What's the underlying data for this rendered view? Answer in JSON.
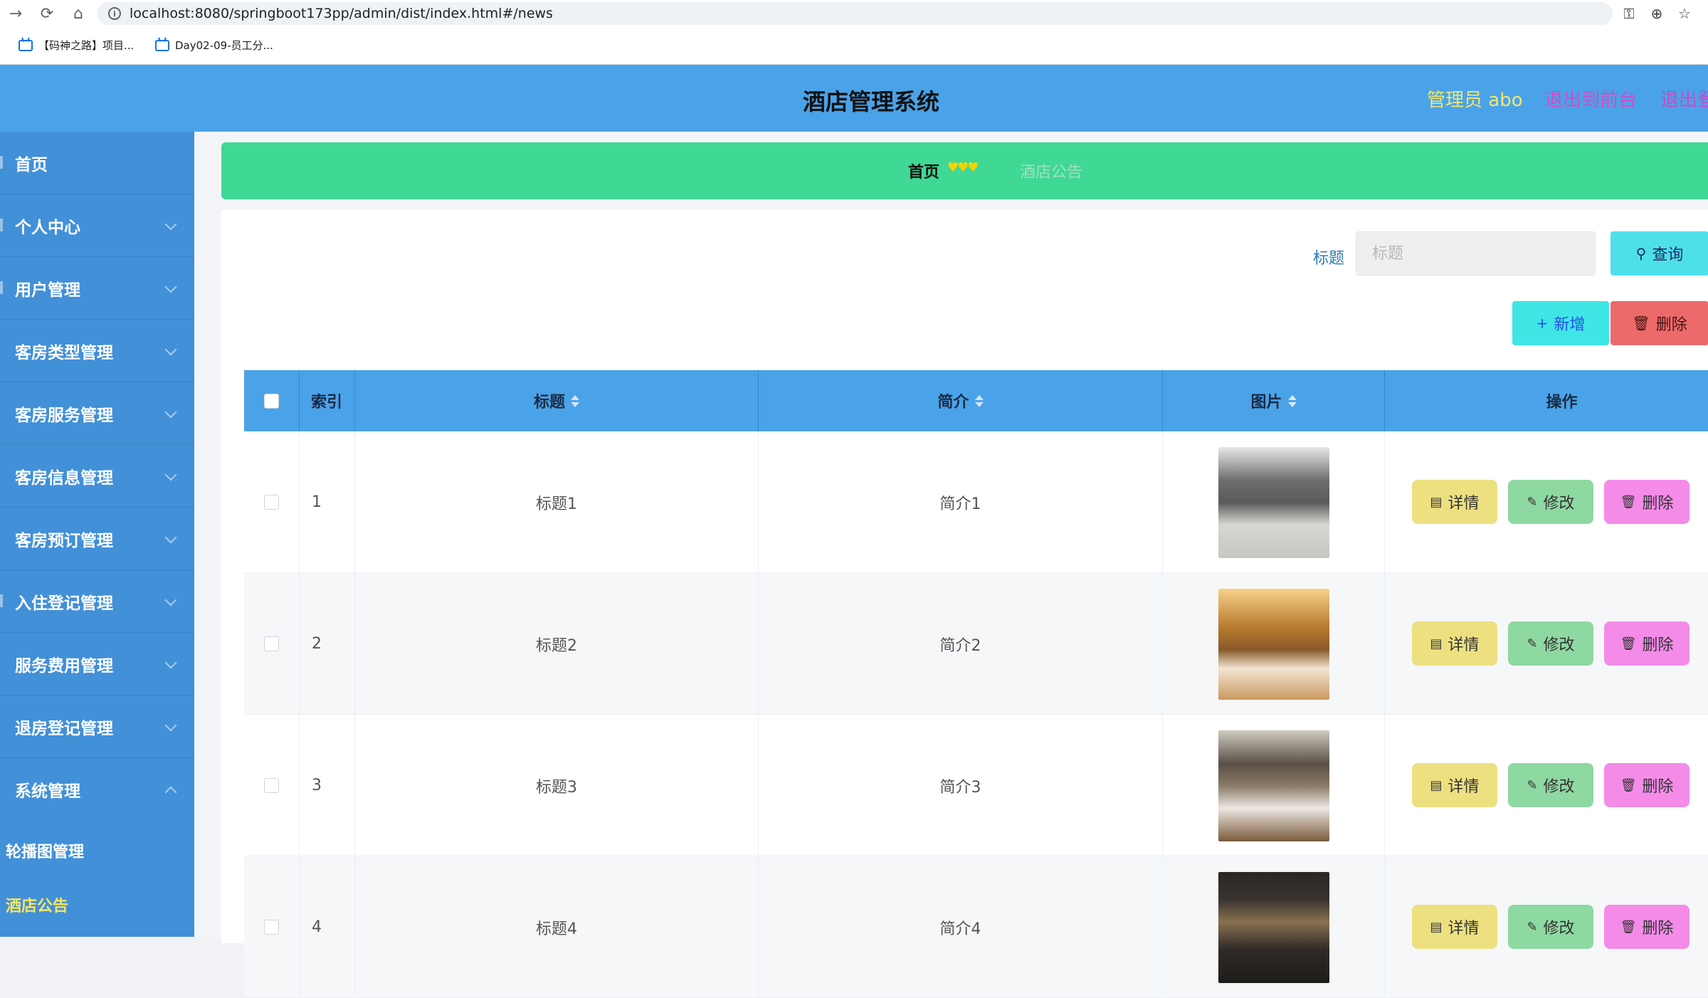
{
  "browser": {
    "url": "localhost:8080/springboot173pp/admin/dist/index.html#/news",
    "bookmarks": [
      "【码神之路】项目...",
      "Day02-09-员工分..."
    ]
  },
  "header": {
    "title": "酒店管理系统",
    "user": "管理员 abo",
    "to_front": "退出到前台",
    "logout": "退出登录"
  },
  "colors": {
    "header_bg": "#4aa3e8",
    "sidebar_bg": "#4290d8",
    "breadcrumb_bg": "#40d895",
    "user_color": "#f3e66c",
    "to_front_color": "#d14cc8",
    "logout_color": "#c84ac8",
    "active_menu_color": "#f5e663"
  },
  "sidebar": {
    "items": [
      {
        "label": "首页",
        "icon": "home-icon",
        "expandable": false
      },
      {
        "label": "个人中心",
        "icon": "user-icon",
        "expandable": true
      },
      {
        "label": "用户管理",
        "icon": "users-icon",
        "expandable": true
      },
      {
        "label": "客房类型管理",
        "icon": "menu-icon",
        "expandable": true
      },
      {
        "label": "客房服务管理",
        "icon": "menu-icon",
        "expandable": true
      },
      {
        "label": "客房信息管理",
        "icon": "menu-icon",
        "expandable": true
      },
      {
        "label": "客房预订管理",
        "icon": "menu-icon",
        "expandable": true
      },
      {
        "label": "入住登记管理",
        "icon": "menu-icon",
        "expandable": true
      },
      {
        "label": "服务费用管理",
        "icon": "menu-icon",
        "expandable": true
      },
      {
        "label": "退房登记管理",
        "icon": "menu-icon",
        "expandable": true
      },
      {
        "label": "系统管理",
        "icon": "menu-icon",
        "expandable": true,
        "expanded": true
      }
    ],
    "subitems": [
      {
        "label": "轮播图管理",
        "active": false
      },
      {
        "label": "酒店公告",
        "active": true
      }
    ]
  },
  "breadcrumb": {
    "home": "首页",
    "separator": "♥♥♥",
    "current": "酒店公告"
  },
  "search": {
    "label": "标题",
    "placeholder": "标题",
    "value": "",
    "query_button": "查询"
  },
  "actions": {
    "add": "新增",
    "delete": "删除"
  },
  "table": {
    "columns": [
      "",
      "索引",
      "标题",
      "简介",
      "图片",
      "操作"
    ],
    "sortable": [
      false,
      false,
      true,
      true,
      true,
      false
    ],
    "rows": [
      {
        "index": "1",
        "title": "标题1",
        "summary": "简介1",
        "image": "room-grey-bedroom"
      },
      {
        "index": "2",
        "title": "标题2",
        "summary": "简介2",
        "image": "room-warm-twin"
      },
      {
        "index": "3",
        "title": "标题3",
        "summary": "简介3",
        "image": "room-window-suite"
      },
      {
        "index": "4",
        "title": "标题4",
        "summary": "简介4",
        "image": "room-dark-lamp"
      }
    ],
    "row_buttons": {
      "detail": "详情",
      "edit": "修改",
      "remove": "删除"
    }
  }
}
